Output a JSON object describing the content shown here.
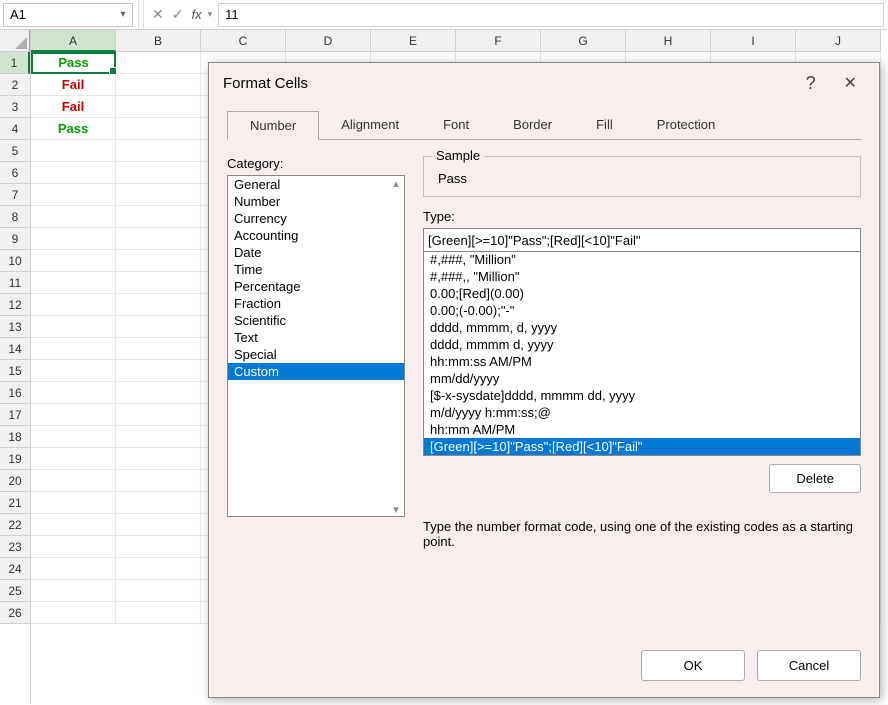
{
  "formula_bar": {
    "name_box": "A1",
    "formula_value": "11"
  },
  "grid": {
    "columns": [
      "A",
      "B",
      "C",
      "D",
      "E",
      "F",
      "G",
      "H",
      "I",
      "J"
    ],
    "rows": [
      1,
      2,
      3,
      4,
      5,
      6,
      7,
      8,
      9,
      10,
      11,
      12,
      13,
      14,
      15,
      16,
      17,
      18,
      19,
      20,
      21,
      22,
      23,
      24,
      25,
      26
    ],
    "active_col": 0,
    "active_row": 0,
    "cells": {
      "r1": {
        "text": "Pass",
        "cls": "pass"
      },
      "r2": {
        "text": "Fail",
        "cls": "fail"
      },
      "r3": {
        "text": "Fail",
        "cls": "fail"
      },
      "r4": {
        "text": "Pass",
        "cls": "pass"
      }
    }
  },
  "dialog": {
    "title": "Format Cells",
    "tabs": [
      "Number",
      "Alignment",
      "Font",
      "Border",
      "Fill",
      "Protection"
    ],
    "active_tab": 0,
    "category_label": "Category:",
    "categories": [
      "General",
      "Number",
      "Currency",
      "Accounting",
      "Date",
      "Time",
      "Percentage",
      "Fraction",
      "Scientific",
      "Text",
      "Special",
      "Custom"
    ],
    "selected_category": 11,
    "sample_label": "Sample",
    "sample_value": "Pass",
    "type_label": "Type:",
    "type_value": "[Green][>=10]\"Pass\";[Red][<10]\"Fail\"",
    "formats": [
      "#,###, \"Million\"",
      "#,###,, \"Million\"",
      "0.00;[Red](0.00)",
      "0.00;(-0.00);\"-\"",
      "dddd, mmmm, d, yyyy",
      "dddd, mmmm d, yyyy",
      "hh:mm:ss AM/PM",
      "mm/dd/yyyy",
      "[$-x-sysdate]dddd, mmmm dd, yyyy",
      "m/d/yyyy h:mm:ss;@",
      "hh:mm AM/PM",
      "[Green][>=10]\"Pass\";[Red][<10]\"Fail\""
    ],
    "selected_format": 11,
    "delete_label": "Delete",
    "hint": "Type the number format code, using one of the existing codes as a starting point.",
    "ok_label": "OK",
    "cancel_label": "Cancel"
  }
}
